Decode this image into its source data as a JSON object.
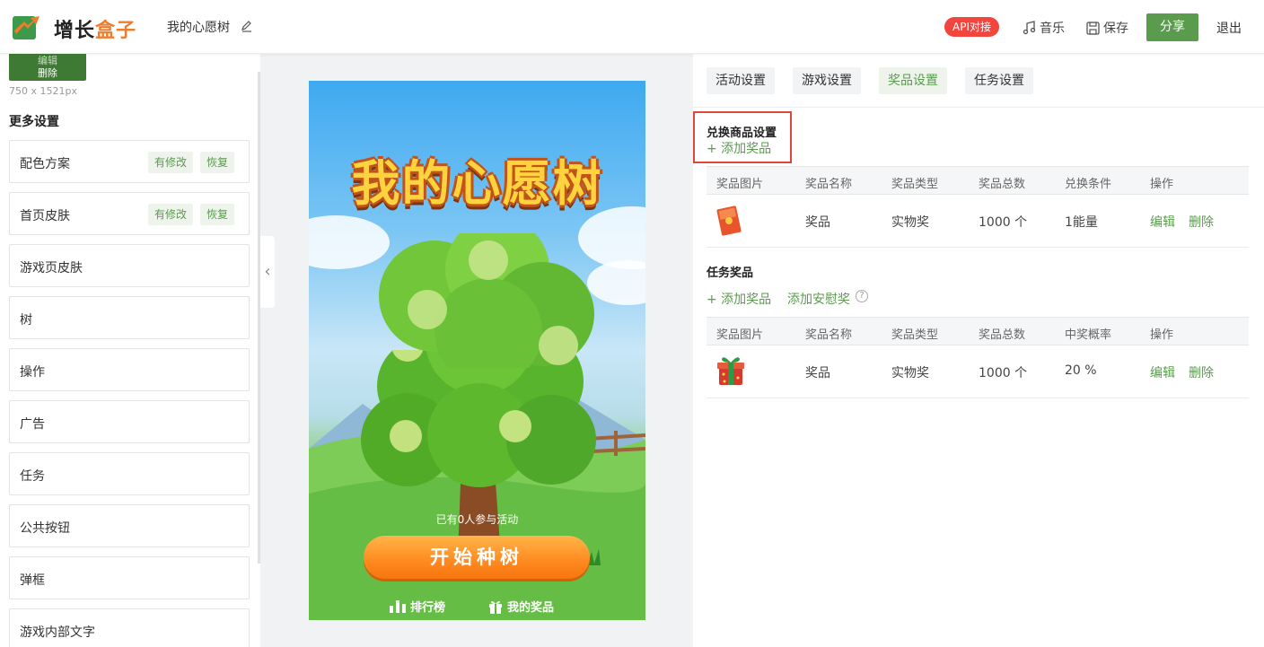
{
  "header": {
    "brand_a": "增长",
    "brand_b": "盒子",
    "title": "我的心愿树",
    "api_badge": "API对接",
    "music": "音乐",
    "save": "保存",
    "share": "分享",
    "exit": "退出",
    "accent_color": "#5a9b4e"
  },
  "sidebar": {
    "thumb_edit": "编辑",
    "thumb_delete": "删除",
    "dimensions": "750 x 1521px",
    "more_settings": "更多设置",
    "modified_tag": "有修改",
    "restore_tag": "恢复",
    "items": [
      {
        "label": "配色方案"
      },
      {
        "label": "首页皮肤"
      },
      {
        "label": "游戏页皮肤"
      },
      {
        "label": "树"
      },
      {
        "label": "操作"
      },
      {
        "label": "广告"
      },
      {
        "label": "任务"
      },
      {
        "label": "公共按钮"
      },
      {
        "label": "弹框"
      },
      {
        "label": "游戏内部文字"
      }
    ]
  },
  "preview": {
    "game_title": "我的心愿树",
    "participants": "已有0人参与活动",
    "start_button": "开始种树",
    "nav_rank": "排行榜",
    "nav_prizes": "我的奖品"
  },
  "tabs": [
    "活动设置",
    "游戏设置",
    "奖品设置",
    "任务设置"
  ],
  "exchange": {
    "title": "兑换商品设置",
    "add": "+ 添加奖品",
    "columns": [
      "奖品图片",
      "奖品名称",
      "奖品类型",
      "奖品总数",
      "兑换条件",
      "操作"
    ],
    "row": {
      "name": "奖品",
      "type": "实物奖",
      "total": "1000 个",
      "condition": "1能量",
      "edit": "编辑",
      "delete": "删除"
    }
  },
  "task": {
    "title": "任务奖品",
    "add": "+ 添加奖品",
    "add_consolation": "添加安慰奖",
    "help": "?",
    "columns": [
      "奖品图片",
      "奖品名称",
      "奖品类型",
      "奖品总数",
      "中奖概率",
      "操作"
    ],
    "row": {
      "name": "奖品",
      "type": "实物奖",
      "total": "1000 个",
      "probability": "20 %",
      "edit": "编辑",
      "delete": "删除"
    }
  }
}
